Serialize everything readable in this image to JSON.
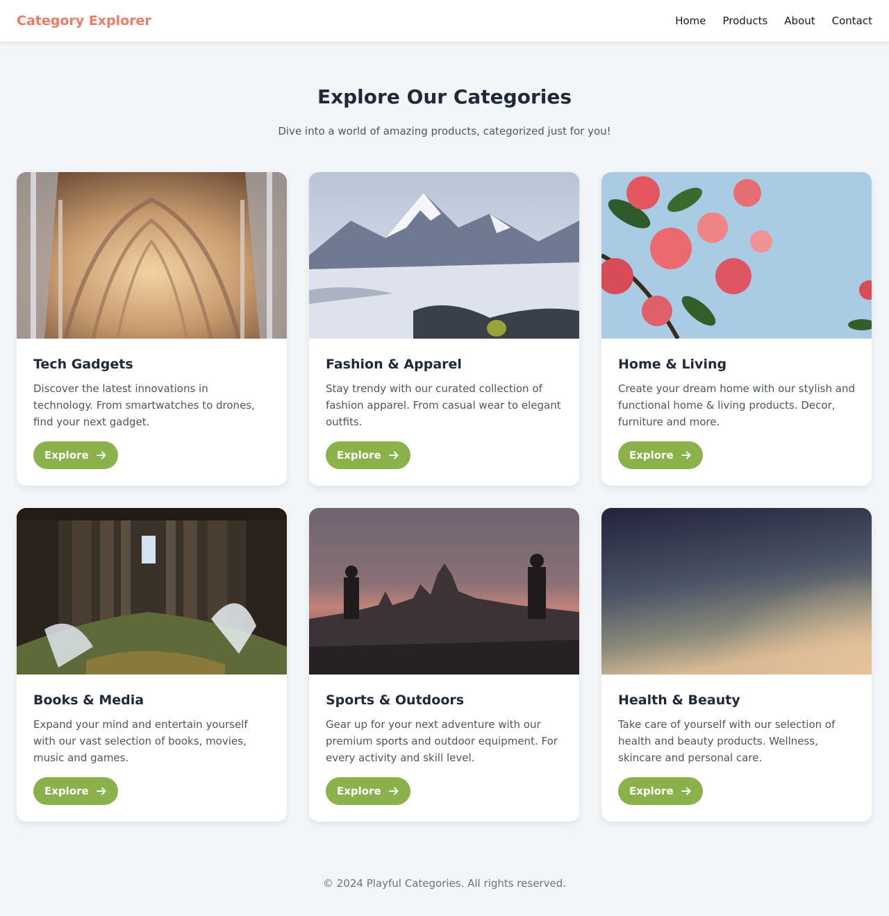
{
  "nav": {
    "brand": "Category Explorer",
    "links": [
      "Home",
      "Products",
      "About",
      "Contact"
    ]
  },
  "hero": {
    "title": "Explore Our Categories",
    "subtitle": "Dive into a world of amazing products, categorized just for you!"
  },
  "categories": [
    {
      "title": "Tech Gadgets",
      "description": "Discover the latest innovations in technology. From smartwatches to drones, find your next gadget.",
      "button": "Explore",
      "image": "cathedral-arches-photo"
    },
    {
      "title": "Fashion & Apparel",
      "description": "Stay trendy with our curated collection of fashion apparel. From casual wear to elegant outfits.",
      "button": "Explore",
      "image": "snowy-mountains-photo"
    },
    {
      "title": "Home & Living",
      "description": "Create your dream home with our stylish and functional home & living products. Decor, furniture and more.",
      "button": "Explore",
      "image": "pink-flowers-photo"
    },
    {
      "title": "Books & Media",
      "description": "Expand your mind and entertain yourself with our vast selection of books, movies, music and games.",
      "button": "Explore",
      "image": "pier-pillars-photo"
    },
    {
      "title": "Sports & Outdoors",
      "description": "Gear up for your next adventure with our premium sports and outdoor equipment. For every activity and skill level.",
      "button": "Explore",
      "image": "bridge-statues-dusk-photo"
    },
    {
      "title": "Health & Beauty",
      "description": "Take care of yourself with our selection of health and beauty products. Wellness, skincare and personal care.",
      "button": "Explore",
      "image": "gradient-sky-photo"
    }
  ],
  "footer": {
    "text": "© 2024 Playful Categories. All rights reserved."
  },
  "colors": {
    "brand": "#f07a63",
    "button": "#8bb24a",
    "background": "#f3f6f9"
  }
}
